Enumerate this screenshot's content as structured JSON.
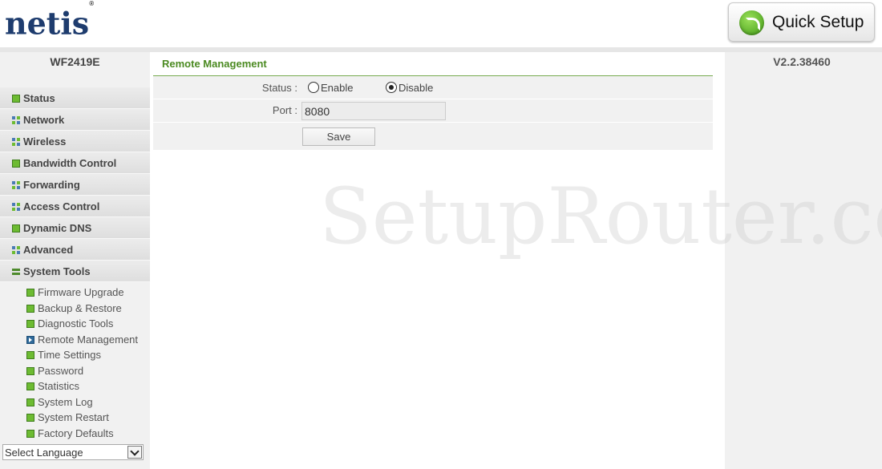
{
  "header": {
    "logo_text": "netis",
    "logo_trademark": "®",
    "quick_setup_label": "Quick Setup"
  },
  "sidebar": {
    "model": "WF2419E",
    "menu": [
      {
        "label": "Status",
        "icon": "green-square-icon"
      },
      {
        "label": "Network",
        "icon": "grid-icon"
      },
      {
        "label": "Wireless",
        "icon": "grid-icon"
      },
      {
        "label": "Bandwidth Control",
        "icon": "green-square-icon"
      },
      {
        "label": "Forwarding",
        "icon": "grid-icon"
      },
      {
        "label": "Access Control",
        "icon": "grid-icon"
      },
      {
        "label": "Dynamic DNS",
        "icon": "green-square-icon"
      },
      {
        "label": "Advanced",
        "icon": "grid-icon"
      },
      {
        "label": "System Tools",
        "icon": "expanded-bars-icon"
      }
    ],
    "submenu": [
      {
        "label": "Firmware Upgrade"
      },
      {
        "label": "Backup & Restore"
      },
      {
        "label": "Diagnostic Tools"
      },
      {
        "label": "Remote Management",
        "active": true
      },
      {
        "label": "Time Settings"
      },
      {
        "label": "Password"
      },
      {
        "label": "Statistics"
      },
      {
        "label": "System Log"
      },
      {
        "label": "System Restart"
      },
      {
        "label": "Factory Defaults"
      }
    ],
    "language_select": "Select Language"
  },
  "right_panel": {
    "version": "V2.2.38460"
  },
  "main": {
    "title": "Remote Management",
    "status_label": "Status :",
    "enable_label": "Enable",
    "disable_label": "Disable",
    "status_value": "Disable",
    "port_label": "Port :",
    "port_value": "8080",
    "save_label": "Save"
  },
  "watermark": "SetupRouter.com",
  "colors": {
    "brand_blue": "#1e3c6e",
    "accent_green": "#4b8a21",
    "sidebar_bg": "#f1f1f1"
  }
}
